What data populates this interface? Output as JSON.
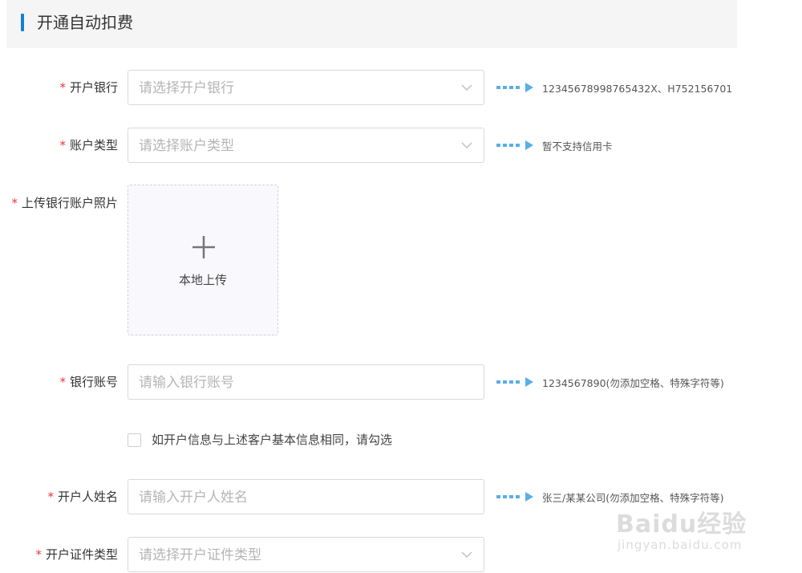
{
  "section": {
    "title": "开通自动扣费"
  },
  "fields": {
    "bank": {
      "label": "开户银行",
      "placeholder": "请选择开户银行",
      "hint": "12345678998765432X、H752156701"
    },
    "account_type": {
      "label": "账户类型",
      "placeholder": "请选择账户类型",
      "hint": "暂不支持信用卡"
    },
    "upload_photo": {
      "label": "上传银行账户照片",
      "button_text": "本地上传"
    },
    "account_number": {
      "label": "银行账号",
      "placeholder": "请输入银行账号",
      "hint": "1234567890(勿添加空格、特殊字符等)"
    },
    "same_info": {
      "label": "如开户信息与上述客户基本信息相同，请勾选",
      "checked": false
    },
    "holder_name": {
      "label": "开户人姓名",
      "placeholder": "请输入开户人姓名",
      "hint": "张三/某某公司(勿添加空格、特殊字符等)"
    },
    "id_type": {
      "label": "开户证件类型",
      "placeholder": "请选择开户证件类型"
    }
  },
  "required_mark": "*",
  "watermark": {
    "main": "Baidu经验",
    "sub": "jingyan.baidu.com"
  },
  "colors": {
    "accent": "#1a7fd4",
    "required": "#e6393d",
    "hint_arrow": "#5aaee6",
    "placeholder": "#b5b5b5"
  }
}
